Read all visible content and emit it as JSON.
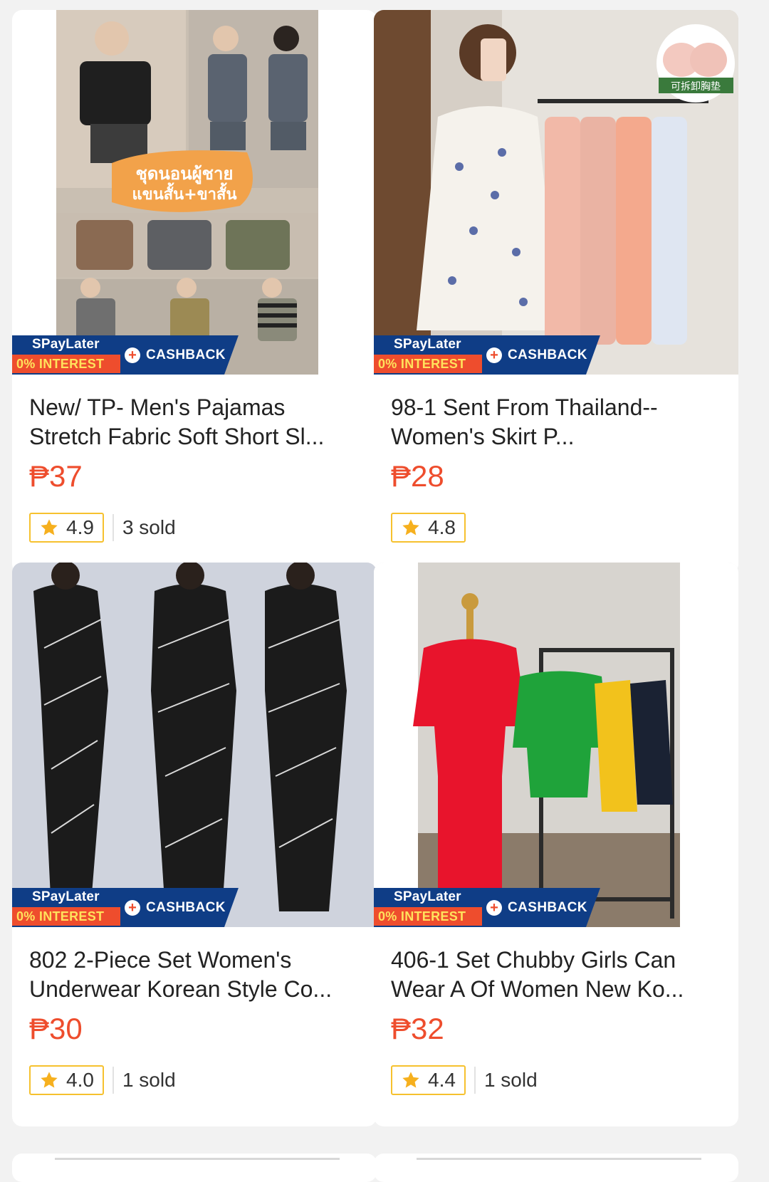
{
  "products": [
    {
      "title": "New/ TP- Men's Pajamas Stretch Fabric Soft Short Sl...",
      "price": "₱37",
      "rating": "4.9",
      "sold": "3 sold",
      "image_text": "ชุดนอนผู้ชาย แขนสั้น+ขาสั้น",
      "badge": {
        "spaylater": "SPayLater",
        "interest": "0% INTEREST",
        "cashback": "CASHBACK"
      }
    },
    {
      "title": "98-1 Sent From Thailand--Women's Skirt P...",
      "price": "₱28",
      "rating": "4.8",
      "sold": "",
      "image_text": "可拆卸胸垫",
      "badge": {
        "spaylater": "SPayLater",
        "interest": "0% INTEREST",
        "cashback": "CASHBACK"
      }
    },
    {
      "title": "802 2-Piece Set Women's Underwear Korean Style Co...",
      "price": "₱30",
      "rating": "4.0",
      "sold": "1 sold",
      "badge": {
        "spaylater": "SPayLater",
        "interest": "0% INTEREST",
        "cashback": "CASHBACK"
      }
    },
    {
      "title": "406-1 Set Chubby Girls Can Wear A Of Women New Ko...",
      "price": "₱32",
      "rating": "4.4",
      "sold": "1 sold",
      "badge": {
        "spaylater": "SPayLater",
        "interest": "0% INTEREST",
        "cashback": "CASHBACK"
      }
    }
  ],
  "colors": {
    "price": "#ee4d2d",
    "badge_blue": "#0f3d86",
    "star": "#f6b01e",
    "rating_border": "#f6c12e"
  },
  "icons": {
    "star": "star-icon",
    "cashback_plus": "plus-icon"
  }
}
